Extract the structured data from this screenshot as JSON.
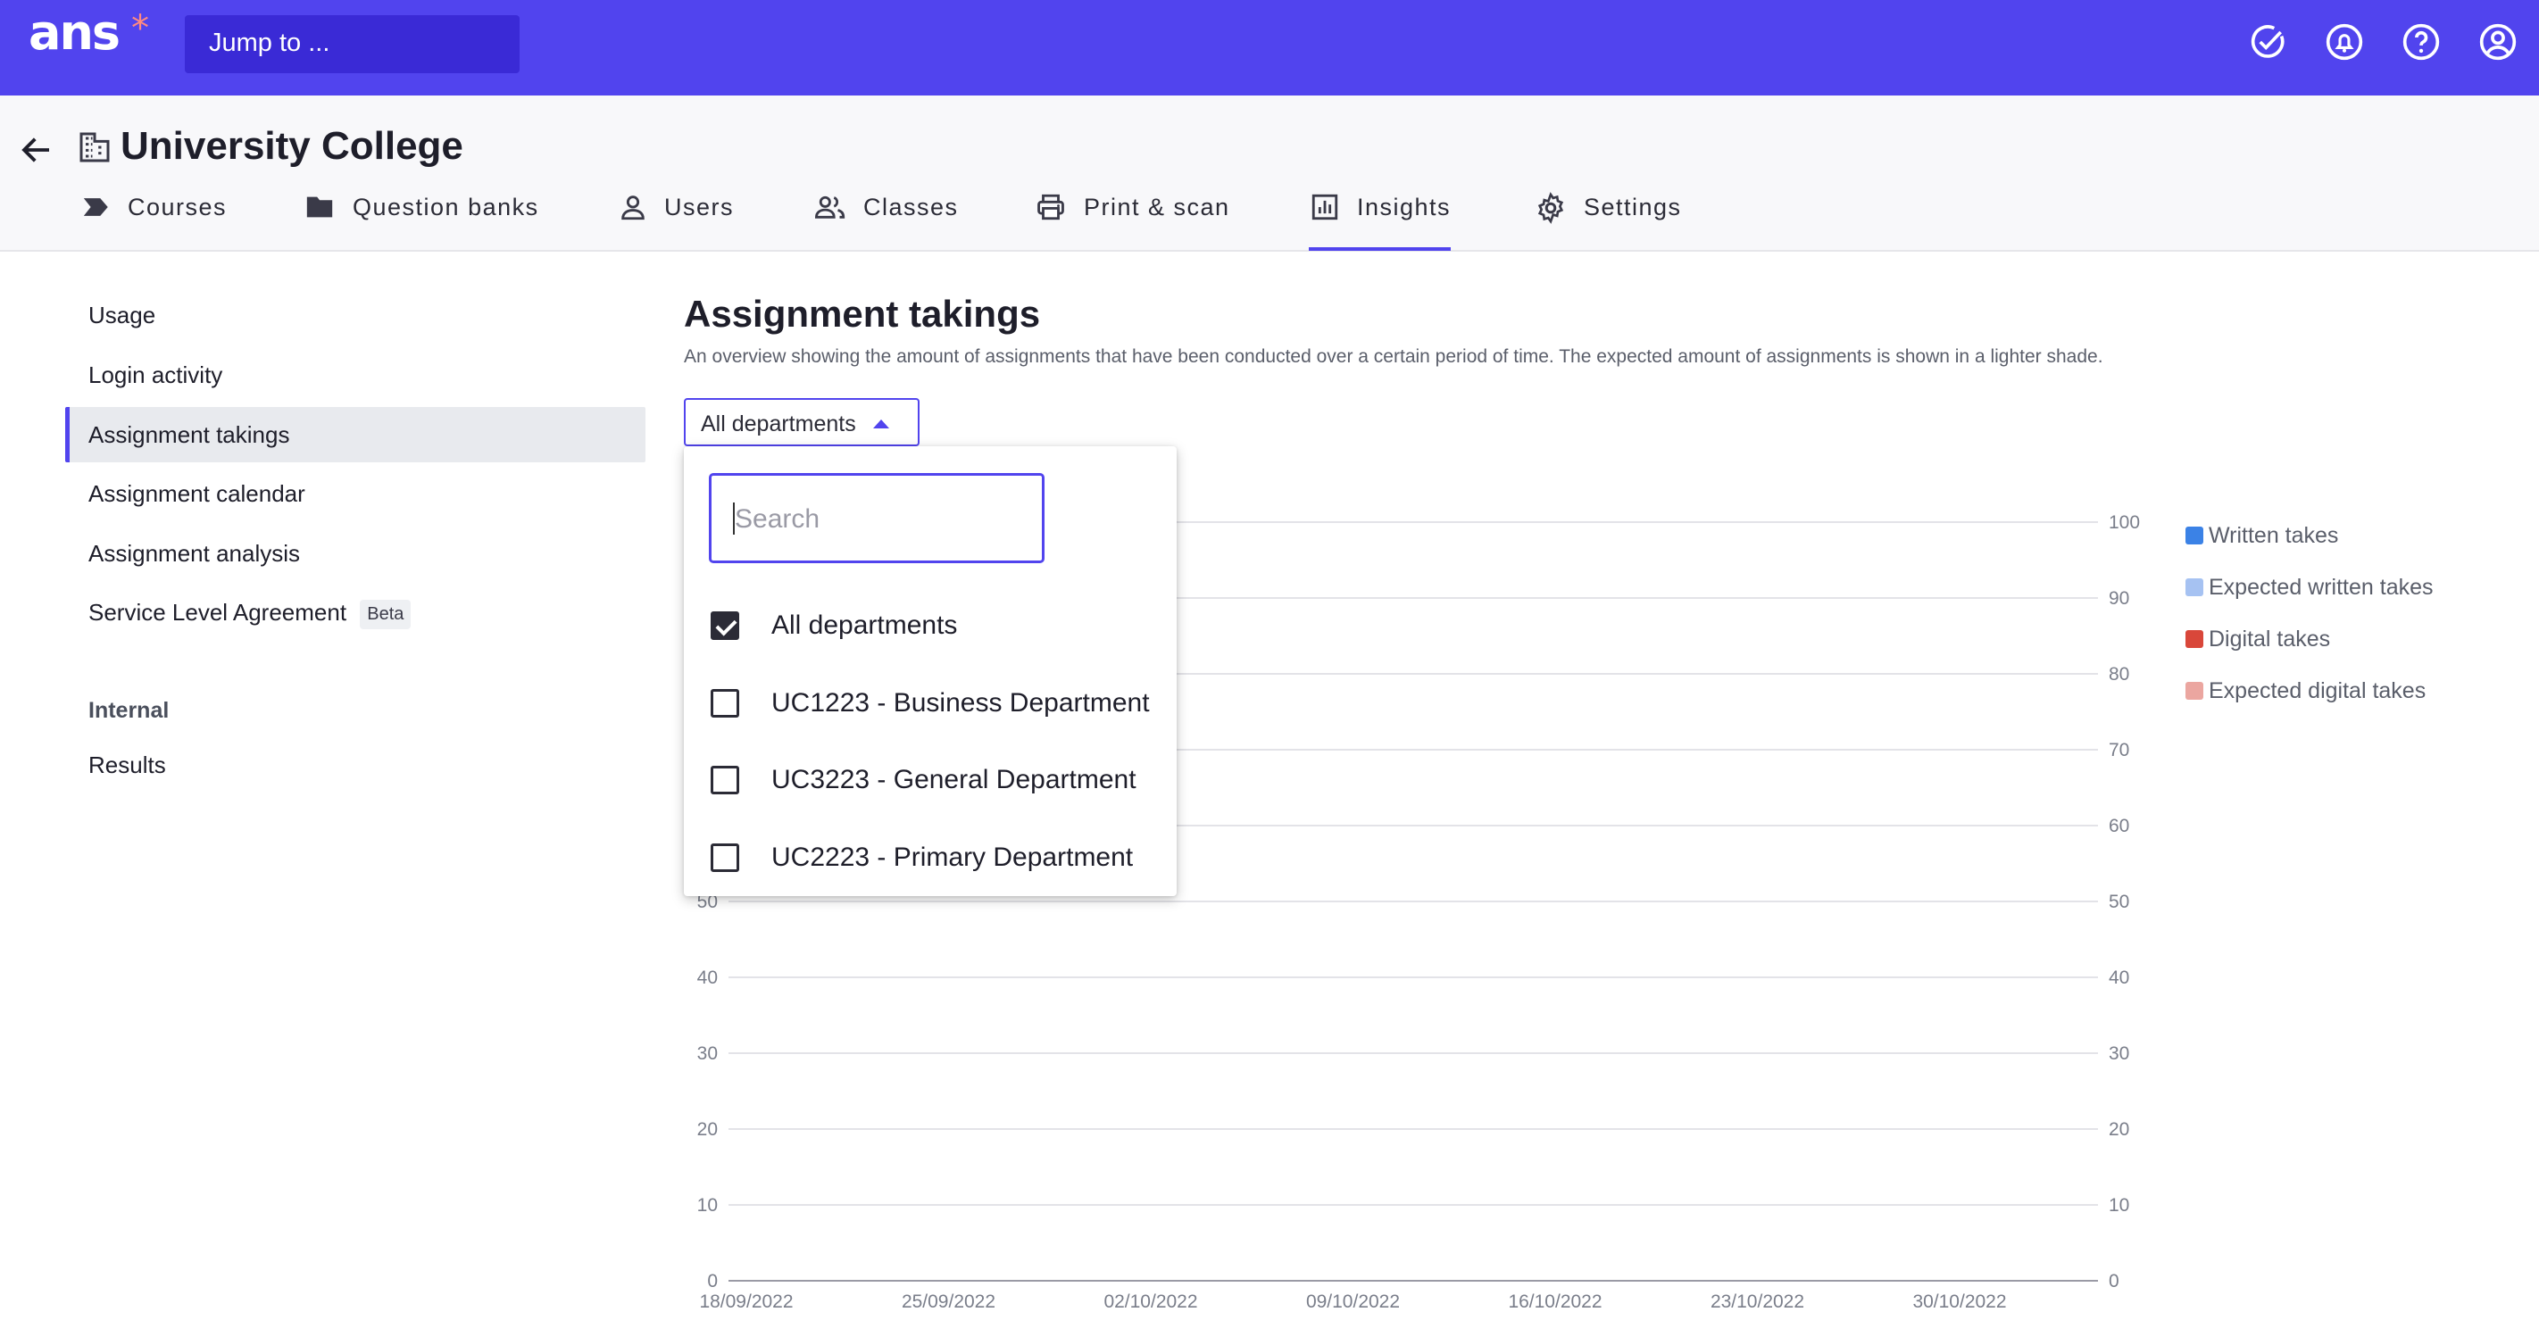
{
  "topbar": {
    "logo": "ans",
    "logo_mark": "*",
    "jump_placeholder": "Jump to ...",
    "icons": [
      "check-circle-icon",
      "bell-icon",
      "help-icon",
      "account-icon"
    ]
  },
  "header": {
    "title": "University College",
    "tabs": [
      {
        "label": "Courses",
        "icon": "courses-icon"
      },
      {
        "label": "Question banks",
        "icon": "folder-icon"
      },
      {
        "label": "Users",
        "icon": "user-icon"
      },
      {
        "label": "Classes",
        "icon": "classes-icon"
      },
      {
        "label": "Print & scan",
        "icon": "printer-icon"
      },
      {
        "label": "Insights",
        "icon": "insights-icon",
        "active": true
      },
      {
        "label": "Settings",
        "icon": "gear-icon"
      }
    ]
  },
  "sidebar": {
    "items": [
      {
        "label": "Usage"
      },
      {
        "label": "Login activity"
      },
      {
        "label": "Assignment takings",
        "active": true
      },
      {
        "label": "Assignment calendar"
      },
      {
        "label": "Assignment analysis"
      },
      {
        "label": "Service Level Agreement",
        "badge": "Beta"
      }
    ],
    "section_title": "Internal",
    "section_items": [
      {
        "label": "Results"
      }
    ]
  },
  "content": {
    "title": "Assignment takings",
    "description": "An overview showing the amount of assignments that have been conducted over a certain period of time. The expected amount of assignments is shown in a lighter shade.",
    "department_filter": {
      "selected": "All departments",
      "search_placeholder": "Search",
      "options": [
        {
          "label": "All departments",
          "checked": true
        },
        {
          "label": "UC1223 - Business Department",
          "checked": false
        },
        {
          "label": "UC3223 - General Department",
          "checked": false
        },
        {
          "label": "UC2223 - Primary Department",
          "checked": false
        }
      ]
    }
  },
  "colors": {
    "brand": "#5144ee",
    "written": "#3b82e6",
    "expected_written": "#a6c2f2",
    "digital": "#d9473a",
    "expected_digital": "#eba6a0"
  },
  "chart_data": {
    "type": "bar",
    "categories": [
      "18/09/2022",
      "25/09/2022",
      "02/10/2022",
      "09/10/2022",
      "16/10/2022",
      "23/10/2022",
      "30/10/2022"
    ],
    "series": [
      {
        "name": "Written takes",
        "values": [
          0,
          0,
          0,
          0,
          0,
          0,
          0
        ]
      },
      {
        "name": "Expected written takes",
        "values": [
          0,
          0,
          0,
          0,
          0,
          0,
          0
        ]
      },
      {
        "name": "Digital takes",
        "values": [
          0,
          0,
          0,
          0,
          0,
          0,
          0
        ]
      },
      {
        "name": "Expected digital takes",
        "values": [
          0,
          0,
          0,
          0,
          0,
          0,
          0
        ]
      }
    ],
    "ylim": [
      0,
      100
    ],
    "yticks": [
      0,
      10,
      20,
      30,
      40,
      50,
      60,
      70,
      80,
      90,
      100
    ],
    "grid": true,
    "legend": "right",
    "xlabel": "",
    "ylabel": ""
  }
}
